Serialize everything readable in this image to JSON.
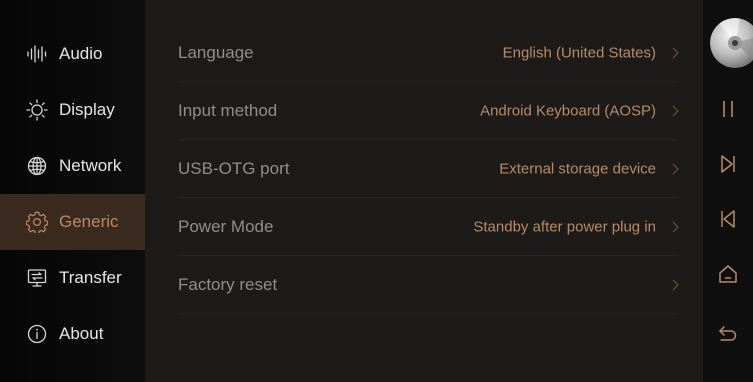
{
  "colors": {
    "accent": "#b98a63",
    "active_bg": "#3b2a1f",
    "label": "#8e8e8e",
    "sidebar_text": "#e6e6e6",
    "icon": "#a9a9a9"
  },
  "sidebar": {
    "items": [
      {
        "label": "Audio",
        "icon": "audio-wave-icon",
        "active": false
      },
      {
        "label": "Display",
        "icon": "brightness-sun-icon",
        "active": false
      },
      {
        "label": "Network",
        "icon": "globe-icon",
        "active": false
      },
      {
        "label": "Generic",
        "icon": "gear-icon",
        "active": true
      },
      {
        "label": "Transfer",
        "icon": "transfer-icon",
        "active": false
      },
      {
        "label": "About",
        "icon": "info-icon",
        "active": false
      }
    ]
  },
  "settings": {
    "rows": [
      {
        "label": "Language",
        "value": "English (United States)"
      },
      {
        "label": "Input method",
        "value": "Android Keyboard (AOSP)"
      },
      {
        "label": "USB-OTG port",
        "value": "External storage device"
      },
      {
        "label": "Power Mode",
        "value": "Standby after power plug in"
      },
      {
        "label": "Factory reset",
        "value": ""
      }
    ]
  },
  "player_controls": {
    "icons": [
      "album-disc-icon",
      "pause-icon",
      "next-track-icon",
      "previous-track-icon",
      "home-icon",
      "back-icon"
    ]
  }
}
